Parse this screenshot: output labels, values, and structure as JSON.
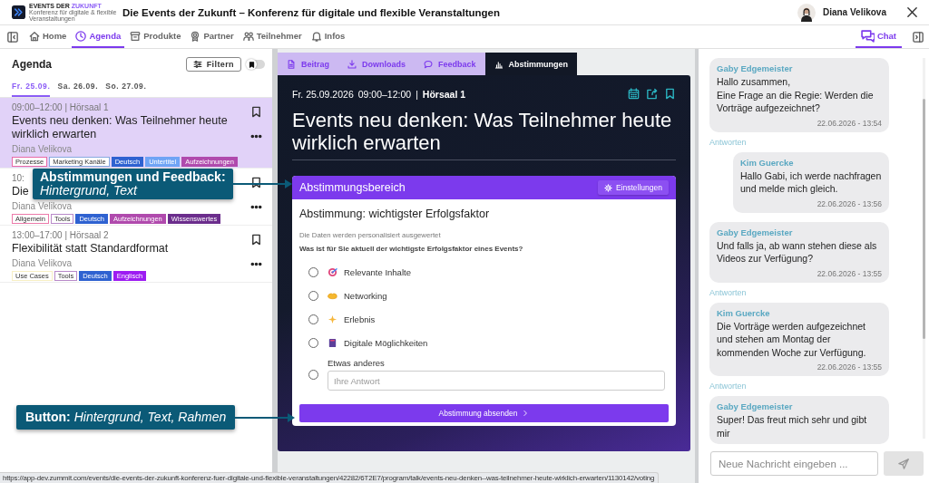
{
  "header": {
    "logo": {
      "name_1": "EVENTS DER",
      "name_2": "ZUKUNFT",
      "tagline": "Konferenz für digitale & flexible Veranstaltungen"
    },
    "title": "Die Events der Zukunft – Konferenz für digitale und flexible Veranstaltungen",
    "user": {
      "name": "Diana Velikova"
    }
  },
  "nav": {
    "tabs": [
      {
        "label": "Home",
        "selected": false
      },
      {
        "label": "Agenda",
        "selected": true
      },
      {
        "label": "Produkte",
        "selected": false
      },
      {
        "label": "Partner",
        "selected": false
      },
      {
        "label": "Teilnehmer",
        "selected": false
      },
      {
        "label": "Infos",
        "selected": false
      }
    ],
    "side_tabs": [
      {
        "label": "Chat",
        "selected": true
      }
    ]
  },
  "agenda": {
    "title": "Agenda",
    "filter_button": "Filtern",
    "bookmark_filter": {
      "on": false
    },
    "days": [
      {
        "label": "Fr. 25.09.",
        "selected": true
      },
      {
        "label": "Sa. 26.09.",
        "selected": false
      },
      {
        "label": "So. 27.09.",
        "selected": false
      }
    ],
    "sessions": [
      {
        "time": "09:00–12:00 | Hörsaal 1",
        "title": "Events neu denken: Was Teilnehmer heute wirklich erwarten",
        "speaker": "Diana Velikova",
        "selected": true,
        "tags": [
          {
            "label": "Prozesse",
            "kind": "outline",
            "color": "#e86aa6"
          },
          {
            "label": "Marketing Kanäle",
            "kind": "outline",
            "color": "#86a9e0"
          },
          {
            "label": "Deutsch",
            "kind": "filled",
            "color": "#2f62d1"
          },
          {
            "label": "Untertitel",
            "kind": "filled",
            "color": "#6fa4f5"
          },
          {
            "label": "Aufzeichnungen",
            "kind": "filled",
            "color": "#b04aad"
          }
        ]
      },
      {
        "time": "10:",
        "title": "Die",
        "speaker": "Diana Velikova",
        "selected": false,
        "tags": [
          {
            "label": "Allgemein",
            "kind": "outline",
            "color": "#ec7aaa"
          },
          {
            "label": "Tools",
            "kind": "outline",
            "color": "#b88ac9"
          },
          {
            "label": "Deutsch",
            "kind": "filled",
            "color": "#2f62d1"
          },
          {
            "label": "Aufzeichnungen",
            "kind": "filled",
            "color": "#b04aad"
          },
          {
            "label": "Wissenswertes",
            "kind": "filled",
            "color": "#6b2d8c"
          }
        ]
      },
      {
        "time": "13:00–17:00 | Hörsaal 2",
        "title": "Flexibilität statt Standardformat",
        "speaker": "Diana Velikova",
        "selected": false,
        "tags": [
          {
            "label": "Use Cases",
            "kind": "outline",
            "color": "#f7efc4"
          },
          {
            "label": "Tools",
            "kind": "outline",
            "color": "#b88ac9"
          },
          {
            "label": "Deutsch",
            "kind": "filled",
            "color": "#2f62d1"
          },
          {
            "label": "Englisch",
            "kind": "filled",
            "color": "#9d1cf2"
          }
        ]
      }
    ]
  },
  "session": {
    "tabs": [
      {
        "label": "Beitrag",
        "selected": false
      },
      {
        "label": "Downloads",
        "selected": false
      },
      {
        "label": "Feedback",
        "selected": false
      },
      {
        "label": "Abstimmungen",
        "selected": true
      }
    ],
    "date": "Fr. 25.09.2026",
    "time": "09:00–12:00",
    "separator": "|",
    "room": "Hörsaal 1",
    "title": "Events neu denken: Was Teilnehmer heute wirklich erwarten",
    "poll": {
      "header": "Abstimmungsbereich",
      "settings_button": "Einstellungen",
      "title": "Abstimmung: wichtigster Erfolgsfaktor",
      "note": "Die Daten werden personalisiert ausgewertet",
      "question": "Was ist für Sie aktuell der wichtigste Erfolgsfaktor eines Events?",
      "options": [
        {
          "kind": "choice",
          "label": "Relevante Inhalte",
          "selected": false
        },
        {
          "kind": "choice",
          "label": "Networking",
          "selected": false
        },
        {
          "kind": "choice",
          "label": "Erlebnis",
          "selected": false
        },
        {
          "kind": "choice",
          "label": "Digitale Möglichkeiten",
          "selected": false
        },
        {
          "kind": "other",
          "label": "Etwas anderes",
          "placeholder": "Ihre Antwort",
          "selected": false
        }
      ],
      "submit_button": "Abstimmung absenden"
    }
  },
  "chat": {
    "messages": [
      {
        "author": "Gaby Edgemeister",
        "text": "Hallo zusammen,\nEine Frage an die Regie: Werden die Vorträge aufgezeichnet?",
        "time": "22.06.2026 - 13:54",
        "reply": false,
        "reply_link": "Antworten"
      },
      {
        "author": "Kim Guercke",
        "text": "Hallo Gabi, ich werde nachfragen und melde mich gleich.",
        "time": "22.06.2026 - 13:56",
        "reply": true
      },
      {
        "author": "Gaby Edgemeister",
        "text": "Und falls ja, ab wann stehen diese als Videos zur Verfügung?",
        "time": "22.06.2026 - 13:55",
        "reply": false,
        "reply_link": "Antworten"
      },
      {
        "author": "Kim Guercke",
        "text": "Die Vorträge werden aufgezeichnet und stehen am Montag der kommenden Woche zur Verfügung.",
        "time": "22.06.2026 - 13:55",
        "reply": false,
        "reply_link": "Antworten"
      },
      {
        "author": "Gaby Edgemeister",
        "text": "Super! Das freut mich sehr und gibt mir",
        "reply": false
      }
    ],
    "input": {
      "placeholder": "Neue Nachricht eingeben ..."
    }
  },
  "annotations": [
    {
      "text": "**Abstimmungen und Feedback:** *Hintergrund, Text*"
    },
    {
      "text": "**Button:** *Hintergrund, Text, Rahmen*"
    }
  ],
  "status_url": "https://app-dev.zummit.com/events/die-events-der-zukunft-konferenz-fuer-digitale-und-flexible-veranstaltungen/42282/6T2E7/program/talk/events-neu-denken--was-teilnehmer-heute-wirklich-erwarten/1130142/voting"
}
